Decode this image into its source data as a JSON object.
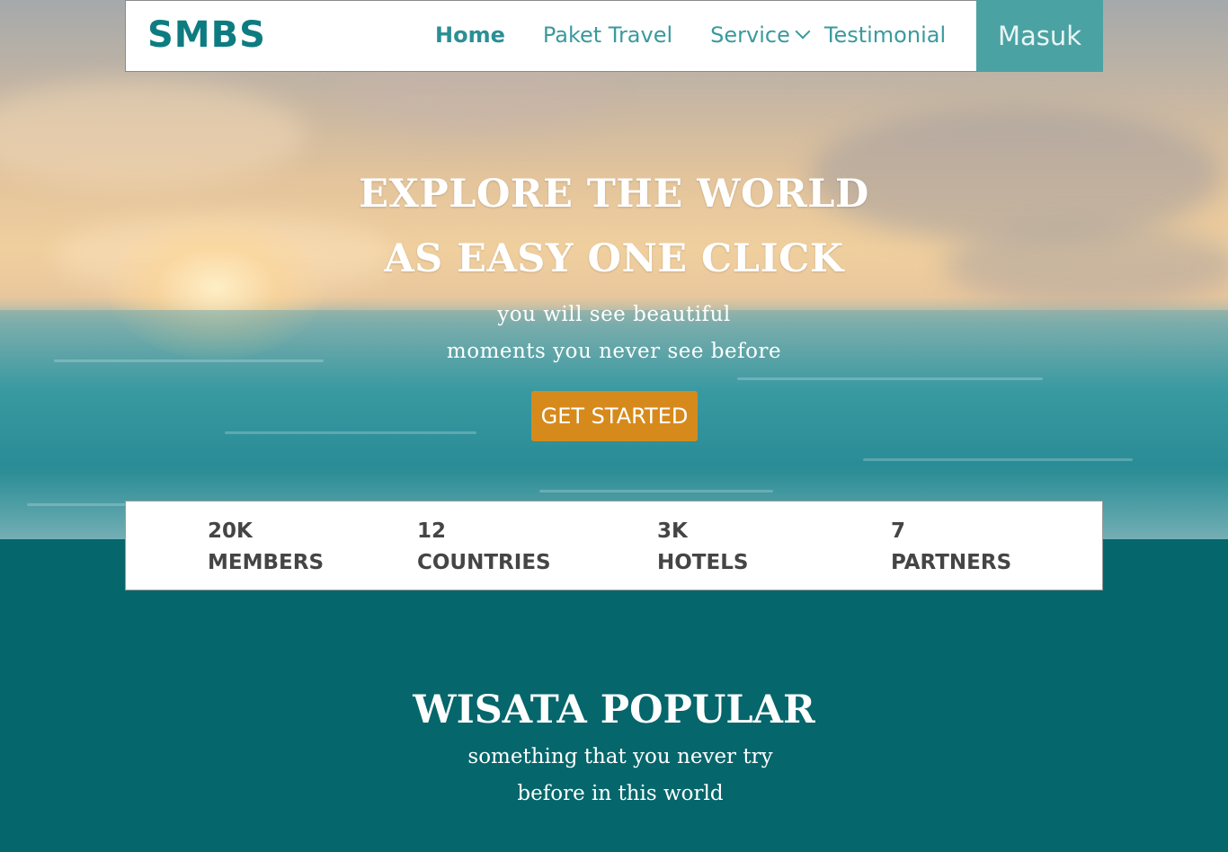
{
  "brand": {
    "logo_text": "SMBS",
    "color": "#0d7c80"
  },
  "nav": {
    "links": [
      {
        "label": "Home",
        "active": true
      },
      {
        "label": "Paket Travel",
        "active": false
      },
      {
        "label": "Service",
        "active": false,
        "has_dropdown": true
      },
      {
        "label": "Testimonial",
        "active": false
      }
    ],
    "login_label": "Masuk"
  },
  "hero": {
    "title_line1": "EXPLORE THE WORLD",
    "title_line2": "AS EASY ONE CLICK",
    "subtitle_line1": "you will see beautiful",
    "subtitle_line2": "moments you never see before",
    "cta_label": "GET STARTED"
  },
  "stats": [
    {
      "value": "20K",
      "label": "MEMBERS"
    },
    {
      "value": "12",
      "label": "COUNTRIES"
    },
    {
      "value": "3K",
      "label": "HOTELS"
    },
    {
      "value": "7",
      "label": "PARTNERS"
    }
  ],
  "popular": {
    "title": "WISATA POPULAR",
    "subtitle_line1": "something that you never try",
    "subtitle_line2": "before in this world"
  },
  "colors": {
    "accent_teal": "#4aa2a3",
    "section_bg": "#05666b",
    "cta": "#d68a1c"
  }
}
